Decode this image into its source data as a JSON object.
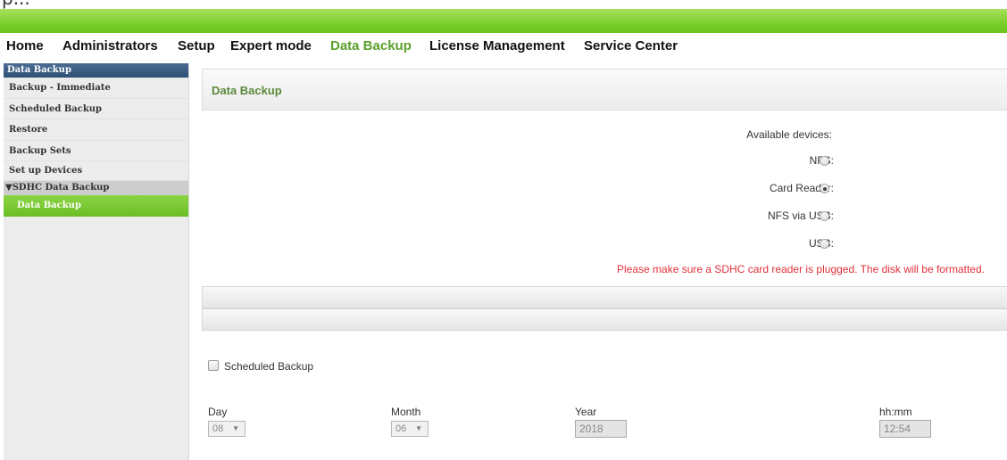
{
  "caption": "p...",
  "nav": {
    "items": [
      "Home",
      "Administrators",
      "Setup",
      "Expert mode",
      "Data Backup",
      "License Management",
      "Service Center"
    ],
    "active": "Data Backup"
  },
  "sidebar": {
    "header": "Data Backup",
    "items": [
      "Backup - Immediate",
      "Scheduled Backup",
      "Restore",
      "Backup Sets",
      "Set up Devices"
    ],
    "group": "▼SDHC Data Backup",
    "active_sub": "Data Backup"
  },
  "main": {
    "title": "Data Backup",
    "available_devices_label": "Available devices:",
    "devices": [
      {
        "label": "NFS:",
        "selected": false
      },
      {
        "label": "Card Reader:",
        "selected": true
      },
      {
        "label": "NFS via USB:",
        "selected": false
      },
      {
        "label": "USB:",
        "selected": false
      }
    ],
    "warning": "Please make sure a SDHC card reader is plugged. The disk will be formatted.",
    "scheduled_backup_label": "Scheduled Backup",
    "scheduled_backup_checked": false,
    "day_label": "Day",
    "day_value": "08",
    "month_label": "Month",
    "month_value": "06",
    "year_label": "Year",
    "year_value": "2018",
    "time_label": "hh:mm",
    "time_value": "12:54"
  },
  "colors": {
    "accent_green": "#6cc21e",
    "active_nav": "#5aa02c",
    "warning_red": "#e0303a",
    "sidebar_header": "#2f4f74"
  }
}
